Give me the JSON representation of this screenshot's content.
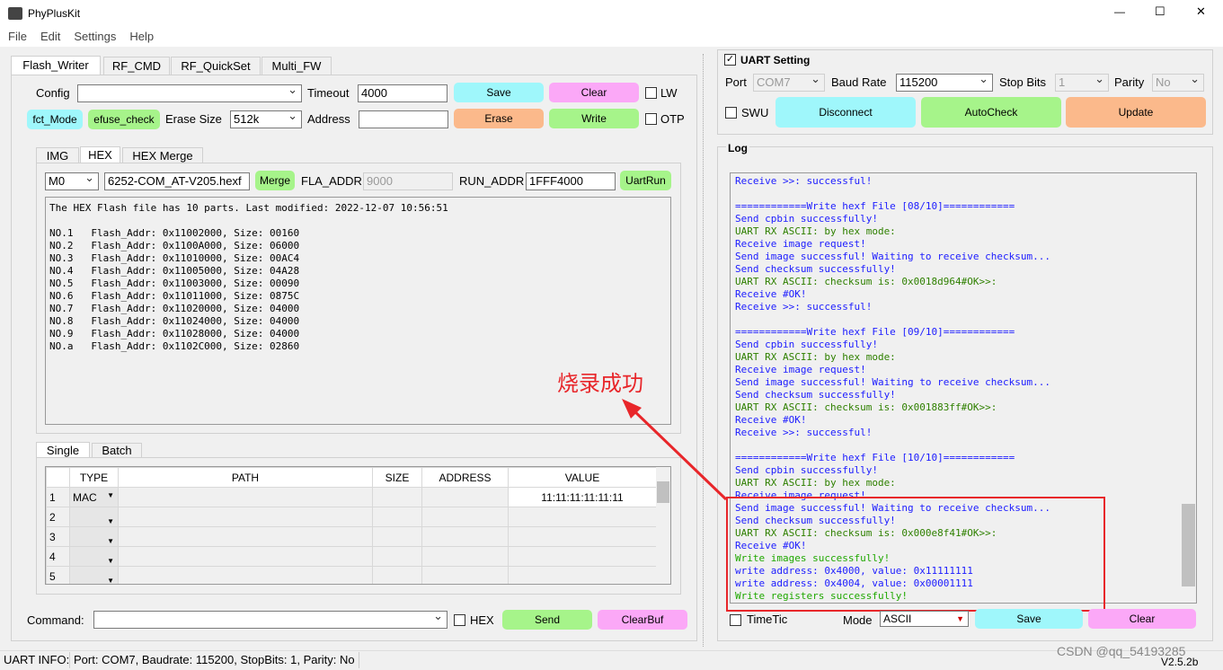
{
  "window": {
    "title": "PhyPlusKit",
    "minimize": "—",
    "maximize": "☐",
    "close": "✕"
  },
  "menu": [
    "File",
    "Edit",
    "Settings",
    "Help"
  ],
  "main_tabs": [
    "Flash_Writer",
    "RF_CMD",
    "RF_QuickSet",
    "Multi_FW"
  ],
  "flash": {
    "config_label": "Config",
    "config_value": "",
    "timeout_label": "Timeout",
    "timeout_value": "4000",
    "save": "Save",
    "clear": "Clear",
    "lw": "LW",
    "fct_mode": "fct_Mode",
    "efuse_check": "efuse_check",
    "erase_size_label": "Erase Size",
    "erase_size_value": "512k",
    "address_label": "Address",
    "address_value": "",
    "erase": "Erase",
    "write": "Write",
    "otp": "OTP"
  },
  "sub_tabs": [
    "IMG",
    "HEX",
    "HEX Merge"
  ],
  "hex": {
    "mode": "M0",
    "file": "6252-COM_AT-V205.hexf",
    "merge": "Merge",
    "fla_addr_label": "FLA_ADDR",
    "fla_addr_value": "9000",
    "run_addr_label": "RUN_ADDR",
    "run_addr_value": "1FFF4000",
    "uartrun": "UartRun",
    "output": [
      "The HEX Flash file has 10 parts. Last modified: 2022-12-07 10:56:51",
      "",
      "NO.1   Flash_Addr: 0x11002000, Size: 00160",
      "NO.2   Flash_Addr: 0x1100A000, Size: 06000",
      "NO.3   Flash_Addr: 0x11010000, Size: 00AC4",
      "NO.4   Flash_Addr: 0x11005000, Size: 04A28",
      "NO.5   Flash_Addr: 0x11003000, Size: 00090",
      "NO.6   Flash_Addr: 0x11011000, Size: 0875C",
      "NO.7   Flash_Addr: 0x11020000, Size: 04000",
      "NO.8   Flash_Addr: 0x11024000, Size: 04000",
      "NO.9   Flash_Addr: 0x11028000, Size: 04000",
      "NO.a   Flash_Addr: 0x1102C000, Size: 02860"
    ]
  },
  "annotation": {
    "text": "烧录成功",
    "color": "#e8262a"
  },
  "bottom_tabs": [
    "Single",
    "Batch"
  ],
  "table": {
    "headers": [
      "",
      "TYPE",
      "PATH",
      "SIZE",
      "ADDRESS",
      "VALUE"
    ],
    "rows": [
      {
        "n": "1",
        "type": "MAC",
        "value": "11:11:11:11:11:11"
      },
      {
        "n": "2",
        "type": "",
        "value": ""
      },
      {
        "n": "3",
        "type": "",
        "value": ""
      },
      {
        "n": "4",
        "type": "",
        "value": ""
      },
      {
        "n": "5",
        "type": "",
        "value": ""
      }
    ]
  },
  "command": {
    "label": "Command:",
    "value": "",
    "hex": "HEX",
    "send": "Send",
    "clearbuf": "ClearBuf"
  },
  "uart": {
    "title": "UART Setting",
    "port_label": "Port",
    "port": "COM7",
    "baud_label": "Baud Rate",
    "baud": "115200",
    "stop_label": "Stop Bits",
    "stop": "1",
    "parity_label": "Parity",
    "parity": "No",
    "swu": "SWU",
    "disconnect": "Disconnect",
    "autocheck": "AutoCheck",
    "update": "Update"
  },
  "log": {
    "title": "Log",
    "lines": [
      {
        "t": "Receive >>: successful!",
        "c": "b"
      },
      {
        "t": "",
        "c": "b"
      },
      {
        "t": "============Write hexf File [08/10]============",
        "c": "b"
      },
      {
        "t": "Send cpbin successfully!",
        "c": "b"
      },
      {
        "t": "UART RX ASCII: by hex mode:",
        "c": "g"
      },
      {
        "t": "Receive image request!",
        "c": "b"
      },
      {
        "t": "Send image successful! Waiting to receive checksum...",
        "c": "b"
      },
      {
        "t": "Send checksum successfully!",
        "c": "b"
      },
      {
        "t": "UART RX ASCII: checksum is: 0x0018d964#OK>>:",
        "c": "g"
      },
      {
        "t": "Receive #OK!",
        "c": "b"
      },
      {
        "t": "Receive >>: successful!",
        "c": "b"
      },
      {
        "t": "",
        "c": "b"
      },
      {
        "t": "============Write hexf File [09/10]============",
        "c": "b"
      },
      {
        "t": "Send cpbin successfully!",
        "c": "b"
      },
      {
        "t": "UART RX ASCII: by hex mode:",
        "c": "g"
      },
      {
        "t": "Receive image request!",
        "c": "b"
      },
      {
        "t": "Send image successful! Waiting to receive checksum...",
        "c": "b"
      },
      {
        "t": "Send checksum successfully!",
        "c": "b"
      },
      {
        "t": "UART RX ASCII: checksum is: 0x001883ff#OK>>:",
        "c": "g"
      },
      {
        "t": "Receive #OK!",
        "c": "b"
      },
      {
        "t": "Receive >>: successful!",
        "c": "b"
      },
      {
        "t": "",
        "c": "b"
      },
      {
        "t": "============Write hexf File [10/10]============",
        "c": "b"
      },
      {
        "t": "Send cpbin successfully!",
        "c": "b"
      },
      {
        "t": "UART RX ASCII: by hex mode:",
        "c": "g"
      },
      {
        "t": "Receive image request!",
        "c": "b"
      },
      {
        "t": "Send image successful! Waiting to receive checksum...",
        "c": "b"
      },
      {
        "t": "Send checksum successfully!",
        "c": "b"
      },
      {
        "t": "UART RX ASCII: checksum is: 0x000e8f41#OK>>:",
        "c": "g"
      },
      {
        "t": "Receive #OK!",
        "c": "b"
      },
      {
        "t": "Write images successfully!",
        "c": "lg"
      },
      {
        "t": "write address: 0x4000, value: 0x11111111",
        "c": "b"
      },
      {
        "t": "write address: 0x4004, value: 0x00001111",
        "c": "b"
      },
      {
        "t": "Write registers successfully!",
        "c": "lg"
      }
    ],
    "timetic": "TimeTic",
    "mode_label": "Mode",
    "mode": "ASCII",
    "save": "Save",
    "clear": "Clear"
  },
  "status": {
    "label": "UART INFO:",
    "info": "Port: COM7, Baudrate: 115200, StopBits: 1, Parity: No",
    "version": "V2.5.2b"
  },
  "watermark": "CSDN @qq_54193285"
}
